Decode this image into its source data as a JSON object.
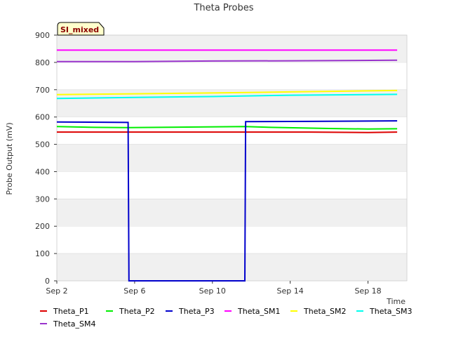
{
  "chart_data": {
    "type": "line",
    "title": "Theta Probes",
    "xlabel": "Time",
    "ylabel": "Probe Output (mV)",
    "badge": "SI_mixed",
    "ylim": [
      0,
      900
    ],
    "yticks": [
      0,
      100,
      200,
      300,
      400,
      500,
      600,
      700,
      800,
      900
    ],
    "xlim": [
      "2024-09-02",
      "2024-09-20"
    ],
    "xticks": [
      "Sep 2",
      "Sep 6",
      "Sep 10",
      "Sep 14",
      "Sep 18"
    ],
    "grid": "horizontal bands",
    "legend_position": "bottom",
    "series": [
      {
        "name": "Theta_P1",
        "color": "#dd0000",
        "x": [
          "2024-09-02",
          "2024-09-05",
          "2024-09-05 16:00",
          "2024-09-11 16:00",
          "2024-09-12",
          "2024-09-15",
          "2024-09-18",
          "2024-09-19 12:00"
        ],
        "y": [
          545,
          545,
          545,
          545,
          545,
          545,
          543,
          545
        ]
      },
      {
        "name": "Theta_P2",
        "color": "#00ee00",
        "x": [
          "2024-09-02",
          "2024-09-04",
          "2024-09-05 16:00",
          "2024-09-11 16:00",
          "2024-09-13",
          "2024-09-16",
          "2024-09-18",
          "2024-09-19 12:00"
        ],
        "y": [
          565,
          562,
          561,
          565,
          562,
          558,
          556,
          557
        ]
      },
      {
        "name": "Theta_P3",
        "color": "#0000cc",
        "x": [
          "2024-09-02",
          "2024-09-05 16:00",
          "2024-09-05 17:00",
          "2024-09-11 16:00",
          "2024-09-11 17:00",
          "2024-09-15",
          "2024-09-19 12:00"
        ],
        "y": [
          582,
          580,
          0,
          0,
          583,
          584,
          586
        ]
      },
      {
        "name": "Theta_SM1",
        "color": "#ff00ff",
        "x": [
          "2024-09-02",
          "2024-09-19 12:00"
        ],
        "y": [
          845,
          845
        ]
      },
      {
        "name": "Theta_SM2",
        "color": "#ffff00",
        "x": [
          "2024-09-02",
          "2024-09-06",
          "2024-09-10",
          "2024-09-14",
          "2024-09-19 12:00"
        ],
        "y": [
          682,
          685,
          688,
          692,
          697
        ]
      },
      {
        "name": "Theta_SM3",
        "color": "#00ffee",
        "x": [
          "2024-09-02",
          "2024-09-06",
          "2024-09-10",
          "2024-09-14",
          "2024-09-19 12:00"
        ],
        "y": [
          668,
          672,
          675,
          680,
          683
        ]
      },
      {
        "name": "Theta_SM4",
        "color": "#9933cc",
        "x": [
          "2024-09-02",
          "2024-09-06",
          "2024-09-10",
          "2024-09-14",
          "2024-09-19 12:00"
        ],
        "y": [
          803,
          803,
          805,
          806,
          808
        ]
      }
    ]
  }
}
